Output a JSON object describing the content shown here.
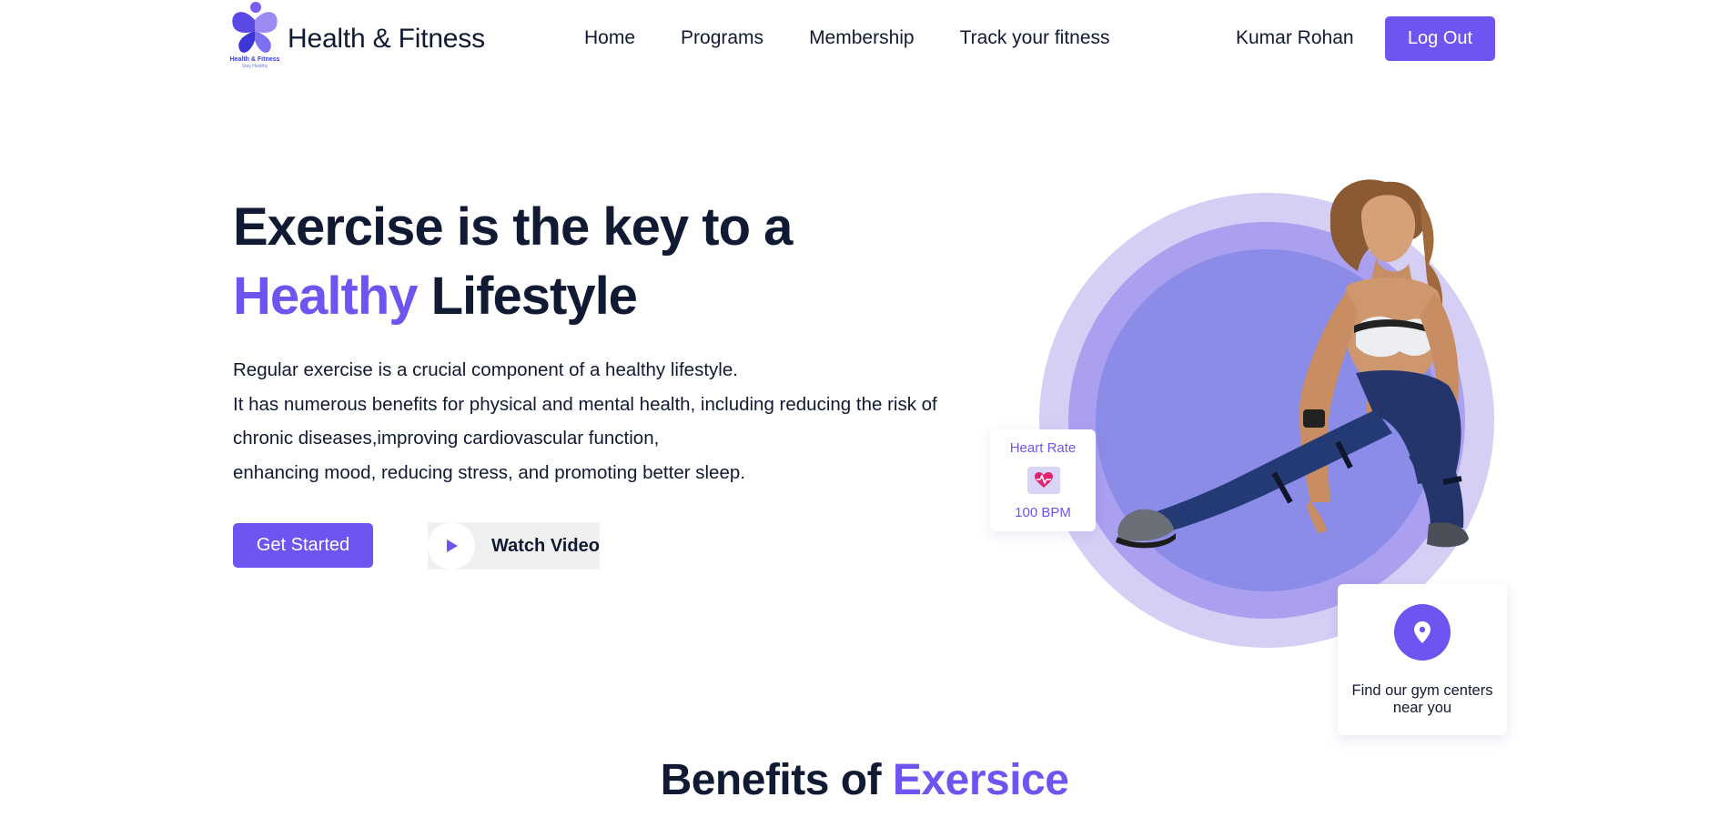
{
  "brand": {
    "name": "Health & Fitness",
    "logo_title": "Health & Fitness",
    "logo_tagline": "Stay Healthy",
    "logo_icon": "butterfly-logo-icon"
  },
  "nav": {
    "links": [
      "Home",
      "Programs",
      "Membership",
      "Track your fitness"
    ],
    "user_name": "Kumar Rohan",
    "logout_label": "Log Out"
  },
  "hero": {
    "title_line1": "Exercise is the key to a",
    "title_accent": "Healthy",
    "title_rest": " Lifestyle",
    "description_lines": [
      "Regular exercise is a crucial component of a healthy lifestyle.",
      "It has numerous benefits for physical and mental health, including reducing the risk of",
      "chronic diseases,improving cardiovascular function,",
      "enhancing mood, reducing stress, and promoting better sleep."
    ],
    "cta_label": "Get Started",
    "video_label": "Watch Video",
    "video_icon": "play-icon"
  },
  "heart_rate_card": {
    "title": "Heart Rate",
    "value": "100 BPM",
    "icon": "heart-pulse-icon"
  },
  "gym_card": {
    "text": "Find our gym centers near you",
    "icon": "location-pin-icon"
  },
  "section": {
    "title_prefix": "Benefits of ",
    "title_accent": "Exersice"
  },
  "colors": {
    "accent": "#6c55f0",
    "text": "#111a33",
    "ring_outer": "#d5cff5",
    "ring_mid": "#ab9ff0",
    "ring_inner": "#8b8ce8"
  }
}
